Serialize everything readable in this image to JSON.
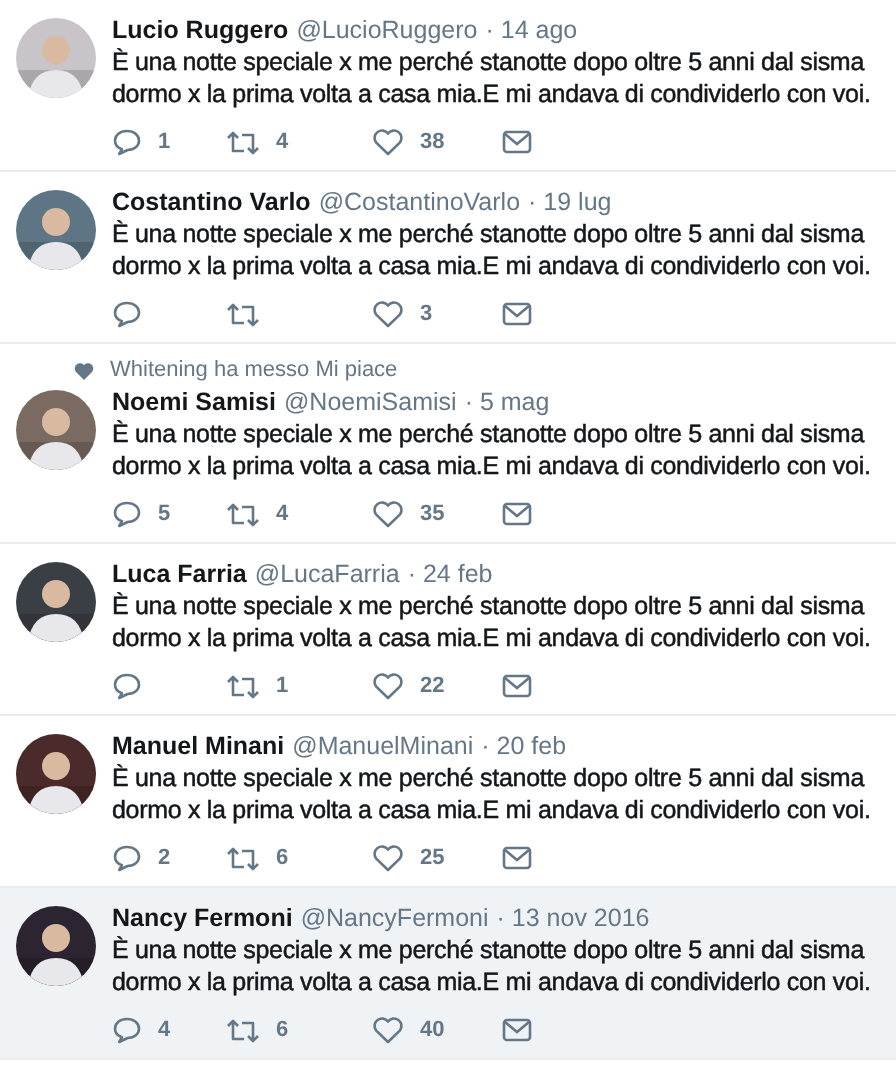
{
  "tweets": [
    {
      "name": "Lucio Ruggero",
      "handle": "@LucioRuggero",
      "time": "· 14 ago",
      "text": "È una notte speciale x me perché stanotte dopo oltre 5 anni dal sisma dormo x la prima volta a casa mia.E mi andava di condividerlo con voi.",
      "replies": "1",
      "retweets": "4",
      "likes": "38",
      "highlighted": false
    },
    {
      "name": "Costantino Varlo",
      "handle": "@CostantinoVarlo",
      "time": "· 19 lug",
      "text": "È una notte speciale x me perché stanotte dopo oltre 5 anni dal sisma dormo x la prima volta a casa mia.E mi andava di condividerlo con voi.",
      "likes": "3",
      "highlighted": false
    },
    {
      "context": "Whitening ha messo Mi piace",
      "name": "Noemi Samisi",
      "handle": "@NoemiSamisi",
      "time": "· 5 mag",
      "text": "È una notte speciale x me perché stanotte dopo oltre 5 anni dal sisma dormo x la prima volta a casa mia.E mi andava di condividerlo con voi.",
      "replies": "5",
      "retweets": "4",
      "likes": "35",
      "highlighted": false
    },
    {
      "name": "Luca Farria",
      "handle": "@LucaFarria",
      "time": "· 24 feb",
      "text": "È una notte speciale x me perché stanotte dopo oltre 5 anni dal sisma dormo x la prima volta a casa mia.E mi andava di condividerlo con voi.",
      "retweets": "1",
      "likes": "22",
      "highlighted": false
    },
    {
      "name": "Manuel Minani",
      "handle": "@ManuelMinani",
      "time": "· 20 feb",
      "text": "È una notte speciale x me perché stanotte dopo oltre 5 anni dal sisma dormo x la prima volta a casa mia.E mi andava di condividerlo con voi.",
      "replies": "2",
      "retweets": "6",
      "likes": "25",
      "highlighted": false
    },
    {
      "name": "Nancy Fermoni",
      "handle": "@NancyFermoni",
      "time": "· 13 nov 2016",
      "text": "È una notte speciale x me perché stanotte dopo oltre 5 anni dal sisma dormo x la prima volta a casa mia.E mi andava di condividerlo con voi.",
      "replies": "4",
      "retweets": "6",
      "likes": "40",
      "highlighted": true
    }
  ]
}
